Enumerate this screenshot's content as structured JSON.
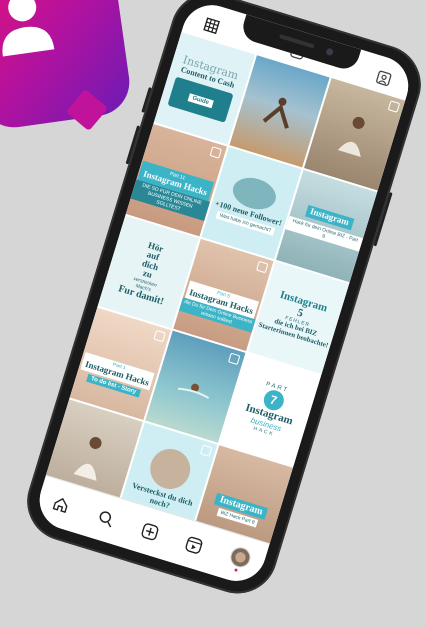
{
  "tiles": [
    {
      "lines": [
        "Instagram",
        "Content to Cash",
        "Guide"
      ]
    },
    {
      "lines": []
    },
    {
      "lines": []
    },
    {
      "lines": [
        "Part 11",
        "Instagram Hacks",
        "DIE SO FÜR DEIN ONLINE BUSINESS WISSEN SOLLTEST"
      ]
    },
    {
      "lines": [
        "+100 neue Follower!",
        "Was habe ich gemacht?"
      ]
    },
    {
      "lines": [
        "Instagram",
        "Hack für dein Online BIZ - Part 9"
      ]
    },
    {
      "lines": [
        "Hör",
        "auf",
        "dich",
        "zu",
        "verstecken",
        "Mach's",
        "Fur damit!"
      ]
    },
    {
      "lines": [
        "Part 6",
        "Instagram Hacks",
        "die Du für Dein Online Business wissen solltest"
      ]
    },
    {
      "lines": [
        "Instagram",
        "5",
        "FEHLER",
        "die ich bei BIZ Starterinnen beobachte!"
      ]
    },
    {
      "lines": [
        "Part 1",
        "Instagram Hacks",
        "To do list - Story"
      ]
    },
    {
      "lines": []
    },
    {
      "lines": [
        "PART",
        "7",
        "Instagram",
        "business",
        "HACK"
      ]
    },
    {
      "lines": []
    },
    {
      "lines": [
        "Versteckst du dich noch?"
      ]
    },
    {
      "lines": [
        "Instagram",
        "BIZ Hack Part 8"
      ]
    }
  ],
  "colors": {
    "accent": "#3bb4c8",
    "teal_bg": "#cfeef3",
    "dark": "#1a1a1a",
    "badge": "#e3127a"
  },
  "icons": [
    "grid-icon",
    "reels-icon",
    "tagged-icon",
    "home-icon",
    "search-icon",
    "new-post-icon",
    "reels-tab-icon",
    "profile-avatar"
  ]
}
